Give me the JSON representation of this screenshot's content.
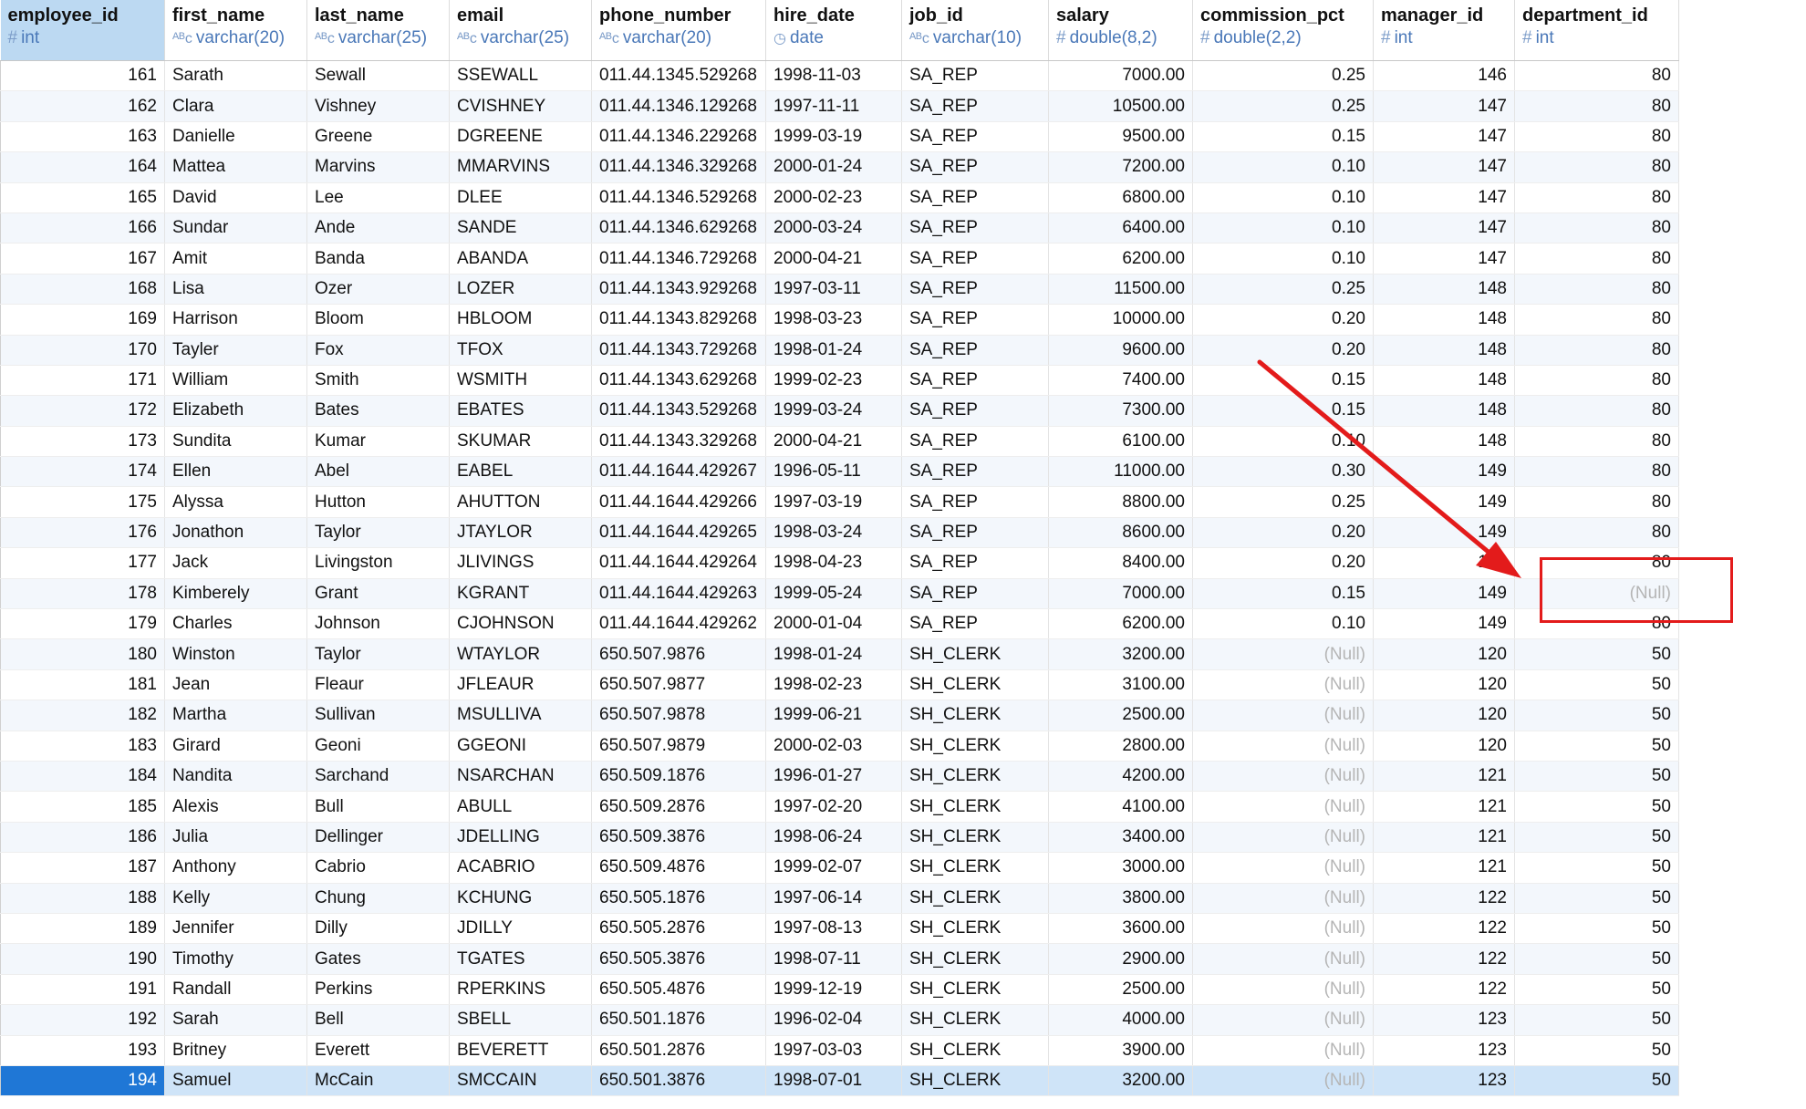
{
  "columns": [
    {
      "name": "employee_id",
      "type": "int",
      "icon": "number-type-icon"
    },
    {
      "name": "first_name",
      "type": "varchar(20)",
      "icon": "text-type-icon"
    },
    {
      "name": "last_name",
      "type": "varchar(25)",
      "icon": "text-type-icon"
    },
    {
      "name": "email",
      "type": "varchar(25)",
      "icon": "text-type-icon"
    },
    {
      "name": "phone_number",
      "type": "varchar(20)",
      "icon": "text-type-icon"
    },
    {
      "name": "hire_date",
      "type": "date",
      "icon": "clock-type-icon"
    },
    {
      "name": "job_id",
      "type": "varchar(10)",
      "icon": "text-type-icon"
    },
    {
      "name": "salary",
      "type": "double(8,2)",
      "icon": "number-type-icon"
    },
    {
      "name": "commission_pct",
      "type": "double(2,2)",
      "icon": "number-type-icon"
    },
    {
      "name": "manager_id",
      "type": "int",
      "icon": "number-type-icon"
    },
    {
      "name": "department_id",
      "type": "int",
      "icon": "number-type-icon"
    }
  ],
  "rows": [
    [
      "161",
      "Sarath",
      "Sewall",
      "SSEWALL",
      "011.44.1345.529268",
      "1998-11-03",
      "SA_REP",
      "7000.00",
      "0.25",
      "146",
      "80"
    ],
    [
      "162",
      "Clara",
      "Vishney",
      "CVISHNEY",
      "011.44.1346.129268",
      "1997-11-11",
      "SA_REP",
      "10500.00",
      "0.25",
      "147",
      "80"
    ],
    [
      "163",
      "Danielle",
      "Greene",
      "DGREENE",
      "011.44.1346.229268",
      "1999-03-19",
      "SA_REP",
      "9500.00",
      "0.15",
      "147",
      "80"
    ],
    [
      "164",
      "Mattea",
      "Marvins",
      "MMARVINS",
      "011.44.1346.329268",
      "2000-01-24",
      "SA_REP",
      "7200.00",
      "0.10",
      "147",
      "80"
    ],
    [
      "165",
      "David",
      "Lee",
      "DLEE",
      "011.44.1346.529268",
      "2000-02-23",
      "SA_REP",
      "6800.00",
      "0.10",
      "147",
      "80"
    ],
    [
      "166",
      "Sundar",
      "Ande",
      "SANDE",
      "011.44.1346.629268",
      "2000-03-24",
      "SA_REP",
      "6400.00",
      "0.10",
      "147",
      "80"
    ],
    [
      "167",
      "Amit",
      "Banda",
      "ABANDA",
      "011.44.1346.729268",
      "2000-04-21",
      "SA_REP",
      "6200.00",
      "0.10",
      "147",
      "80"
    ],
    [
      "168",
      "Lisa",
      "Ozer",
      "LOZER",
      "011.44.1343.929268",
      "1997-03-11",
      "SA_REP",
      "11500.00",
      "0.25",
      "148",
      "80"
    ],
    [
      "169",
      "Harrison",
      "Bloom",
      "HBLOOM",
      "011.44.1343.829268",
      "1998-03-23",
      "SA_REP",
      "10000.00",
      "0.20",
      "148",
      "80"
    ],
    [
      "170",
      "Tayler",
      "Fox",
      "TFOX",
      "011.44.1343.729268",
      "1998-01-24",
      "SA_REP",
      "9600.00",
      "0.20",
      "148",
      "80"
    ],
    [
      "171",
      "William",
      "Smith",
      "WSMITH",
      "011.44.1343.629268",
      "1999-02-23",
      "SA_REP",
      "7400.00",
      "0.15",
      "148",
      "80"
    ],
    [
      "172",
      "Elizabeth",
      "Bates",
      "EBATES",
      "011.44.1343.529268",
      "1999-03-24",
      "SA_REP",
      "7300.00",
      "0.15",
      "148",
      "80"
    ],
    [
      "173",
      "Sundita",
      "Kumar",
      "SKUMAR",
      "011.44.1343.329268",
      "2000-04-21",
      "SA_REP",
      "6100.00",
      "0.10",
      "148",
      "80"
    ],
    [
      "174",
      "Ellen",
      "Abel",
      "EABEL",
      "011.44.1644.429267",
      "1996-05-11",
      "SA_REP",
      "11000.00",
      "0.30",
      "149",
      "80"
    ],
    [
      "175",
      "Alyssa",
      "Hutton",
      "AHUTTON",
      "011.44.1644.429266",
      "1997-03-19",
      "SA_REP",
      "8800.00",
      "0.25",
      "149",
      "80"
    ],
    [
      "176",
      "Jonathon",
      "Taylor",
      "JTAYLOR",
      "011.44.1644.429265",
      "1998-03-24",
      "SA_REP",
      "8600.00",
      "0.20",
      "149",
      "80"
    ],
    [
      "177",
      "Jack",
      "Livingston",
      "JLIVINGS",
      "011.44.1644.429264",
      "1998-04-23",
      "SA_REP",
      "8400.00",
      "0.20",
      "149",
      "80"
    ],
    [
      "178",
      "Kimberely",
      "Grant",
      "KGRANT",
      "011.44.1644.429263",
      "1999-05-24",
      "SA_REP",
      "7000.00",
      "0.15",
      "149",
      "(Null)"
    ],
    [
      "179",
      "Charles",
      "Johnson",
      "CJOHNSON",
      "011.44.1644.429262",
      "2000-01-04",
      "SA_REP",
      "6200.00",
      "0.10",
      "149",
      "80"
    ],
    [
      "180",
      "Winston",
      "Taylor",
      "WTAYLOR",
      "650.507.9876",
      "1998-01-24",
      "SH_CLERK",
      "3200.00",
      "(Null)",
      "120",
      "50"
    ],
    [
      "181",
      "Jean",
      "Fleaur",
      "JFLEAUR",
      "650.507.9877",
      "1998-02-23",
      "SH_CLERK",
      "3100.00",
      "(Null)",
      "120",
      "50"
    ],
    [
      "182",
      "Martha",
      "Sullivan",
      "MSULLIVA",
      "650.507.9878",
      "1999-06-21",
      "SH_CLERK",
      "2500.00",
      "(Null)",
      "120",
      "50"
    ],
    [
      "183",
      "Girard",
      "Geoni",
      "GGEONI",
      "650.507.9879",
      "2000-02-03",
      "SH_CLERK",
      "2800.00",
      "(Null)",
      "120",
      "50"
    ],
    [
      "184",
      "Nandita",
      "Sarchand",
      "NSARCHAN",
      "650.509.1876",
      "1996-01-27",
      "SH_CLERK",
      "4200.00",
      "(Null)",
      "121",
      "50"
    ],
    [
      "185",
      "Alexis",
      "Bull",
      "ABULL",
      "650.509.2876",
      "1997-02-20",
      "SH_CLERK",
      "4100.00",
      "(Null)",
      "121",
      "50"
    ],
    [
      "186",
      "Julia",
      "Dellinger",
      "JDELLING",
      "650.509.3876",
      "1998-06-24",
      "SH_CLERK",
      "3400.00",
      "(Null)",
      "121",
      "50"
    ],
    [
      "187",
      "Anthony",
      "Cabrio",
      "ACABRIO",
      "650.509.4876",
      "1999-02-07",
      "SH_CLERK",
      "3000.00",
      "(Null)",
      "121",
      "50"
    ],
    [
      "188",
      "Kelly",
      "Chung",
      "KCHUNG",
      "650.505.1876",
      "1997-06-14",
      "SH_CLERK",
      "3800.00",
      "(Null)",
      "122",
      "50"
    ],
    [
      "189",
      "Jennifer",
      "Dilly",
      "JDILLY",
      "650.505.2876",
      "1997-08-13",
      "SH_CLERK",
      "3600.00",
      "(Null)",
      "122",
      "50"
    ],
    [
      "190",
      "Timothy",
      "Gates",
      "TGATES",
      "650.505.3876",
      "1998-07-11",
      "SH_CLERK",
      "2900.00",
      "(Null)",
      "122",
      "50"
    ],
    [
      "191",
      "Randall",
      "Perkins",
      "RPERKINS",
      "650.505.4876",
      "1999-12-19",
      "SH_CLERK",
      "2500.00",
      "(Null)",
      "122",
      "50"
    ],
    [
      "192",
      "Sarah",
      "Bell",
      "SBELL",
      "650.501.1876",
      "1996-02-04",
      "SH_CLERK",
      "4000.00",
      "(Null)",
      "123",
      "50"
    ],
    [
      "193",
      "Britney",
      "Everett",
      "BEVERETT",
      "650.501.2876",
      "1997-03-03",
      "SH_CLERK",
      "3900.00",
      "(Null)",
      "123",
      "50"
    ],
    [
      "194",
      "Samuel",
      "McCain",
      "SMCCAIN",
      "650.501.3876",
      "1998-07-01",
      "SH_CLERK",
      "3200.00",
      "(Null)",
      "123",
      "50"
    ]
  ],
  "selected_row": 33,
  "numeric_columns": [
    0,
    7,
    8,
    9,
    10
  ],
  "null_text": "(Null)",
  "colors": {
    "selection": "#1f77d6",
    "selected_row_bg": "#cfe4f8",
    "header_selected_bg": "#bcd9f2",
    "type_text": "#4a78b8",
    "annotation": "#e31b1b"
  }
}
